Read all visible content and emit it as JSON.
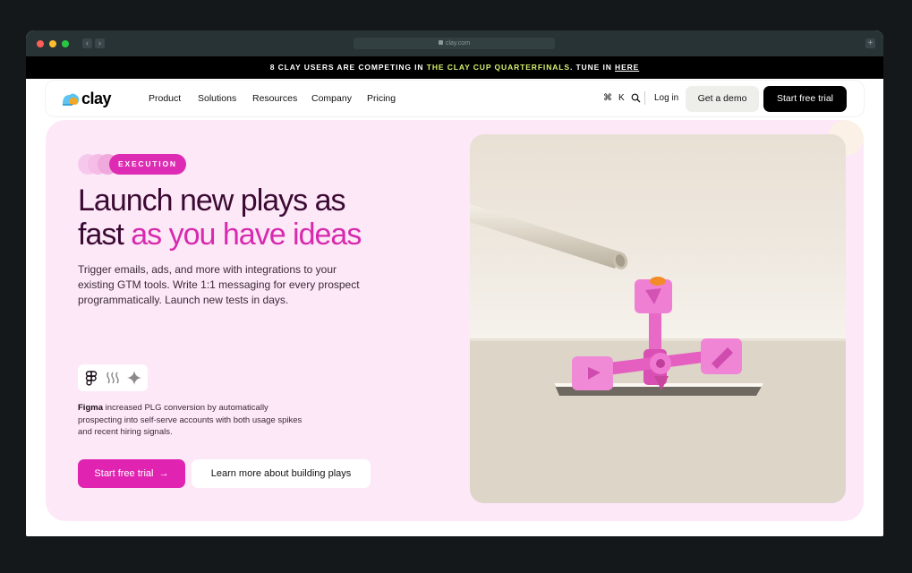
{
  "browser": {
    "url": "clay.com"
  },
  "banner": {
    "text_before": "8 CLAY USERS ARE COMPETING IN ",
    "highlight": "THE CLAY CUP QUARTERFINALS",
    "text_after": ". TUNE IN ",
    "link": "HERE"
  },
  "nav": {
    "logo_text": "clay",
    "links": [
      "Product",
      "Solutions",
      "Resources",
      "Company",
      "Pricing"
    ],
    "shortcut_cmd": "⌘",
    "shortcut_key": "K",
    "login": "Log in",
    "demo": "Get a demo",
    "trial": "Start free trial"
  },
  "hero": {
    "tag": "EXECUTION",
    "headline_line1": "Launch new plays as",
    "headline_line2_plain": "fast ",
    "headline_line2_accent": "as you have ideas",
    "lede": "Trigger emails, ads, and more with integrations to your existing GTM tools. Write 1:1 messaging for every prospect programmatically. Launch new tests in days.",
    "proof_brand": "Figma",
    "proof_text": " increased PLG conversion by automatically prospecting into self-serve accounts with both usage spikes and recent hiring signals.",
    "cta_primary": "Start free trial",
    "cta_primary_arrow": "→",
    "cta_secondary": "Learn more about building plays"
  },
  "colors": {
    "accent": "#de2bb3",
    "hero_bg": "#fde8f8",
    "headline": "#3b0a33",
    "banner_highlight": "#d7f171"
  },
  "icons": [
    "figma-icon",
    "wave-icon",
    "sparkle-icon",
    "search-icon",
    "lock-icon"
  ]
}
